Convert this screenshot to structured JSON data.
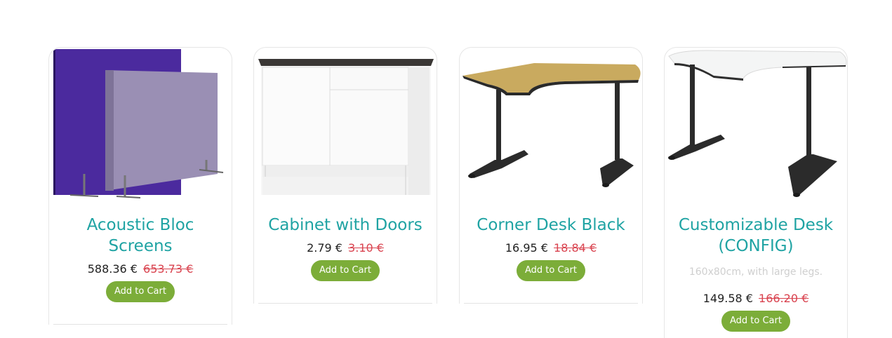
{
  "colors": {
    "title": "#1fa3a3",
    "old_price": "#d9434f",
    "button": "#7cad39",
    "description": "#cfcfcf"
  },
  "products": [
    {
      "name": "Acoustic Bloc Screens",
      "image_icon": "acoustic-screens-image",
      "price": "588.36 €",
      "old_price": "653.73 €",
      "button": "Add to Cart"
    },
    {
      "name": "Cabinet with Doors",
      "image_icon": "cabinet-image",
      "price": "2.79 €",
      "old_price": "3.10 €",
      "button": "Add to Cart"
    },
    {
      "name": "Corner Desk Black",
      "image_icon": "corner-desk-black-image",
      "price": "16.95 €",
      "old_price": "18.84 €",
      "button": "Add to Cart"
    },
    {
      "name": "Customizable Desk (CONFIG)",
      "image_icon": "customizable-desk-image",
      "description": "160x80cm, with large legs.",
      "price": "149.58 €",
      "old_price": "166.20 €",
      "button": "Add to Cart"
    }
  ]
}
